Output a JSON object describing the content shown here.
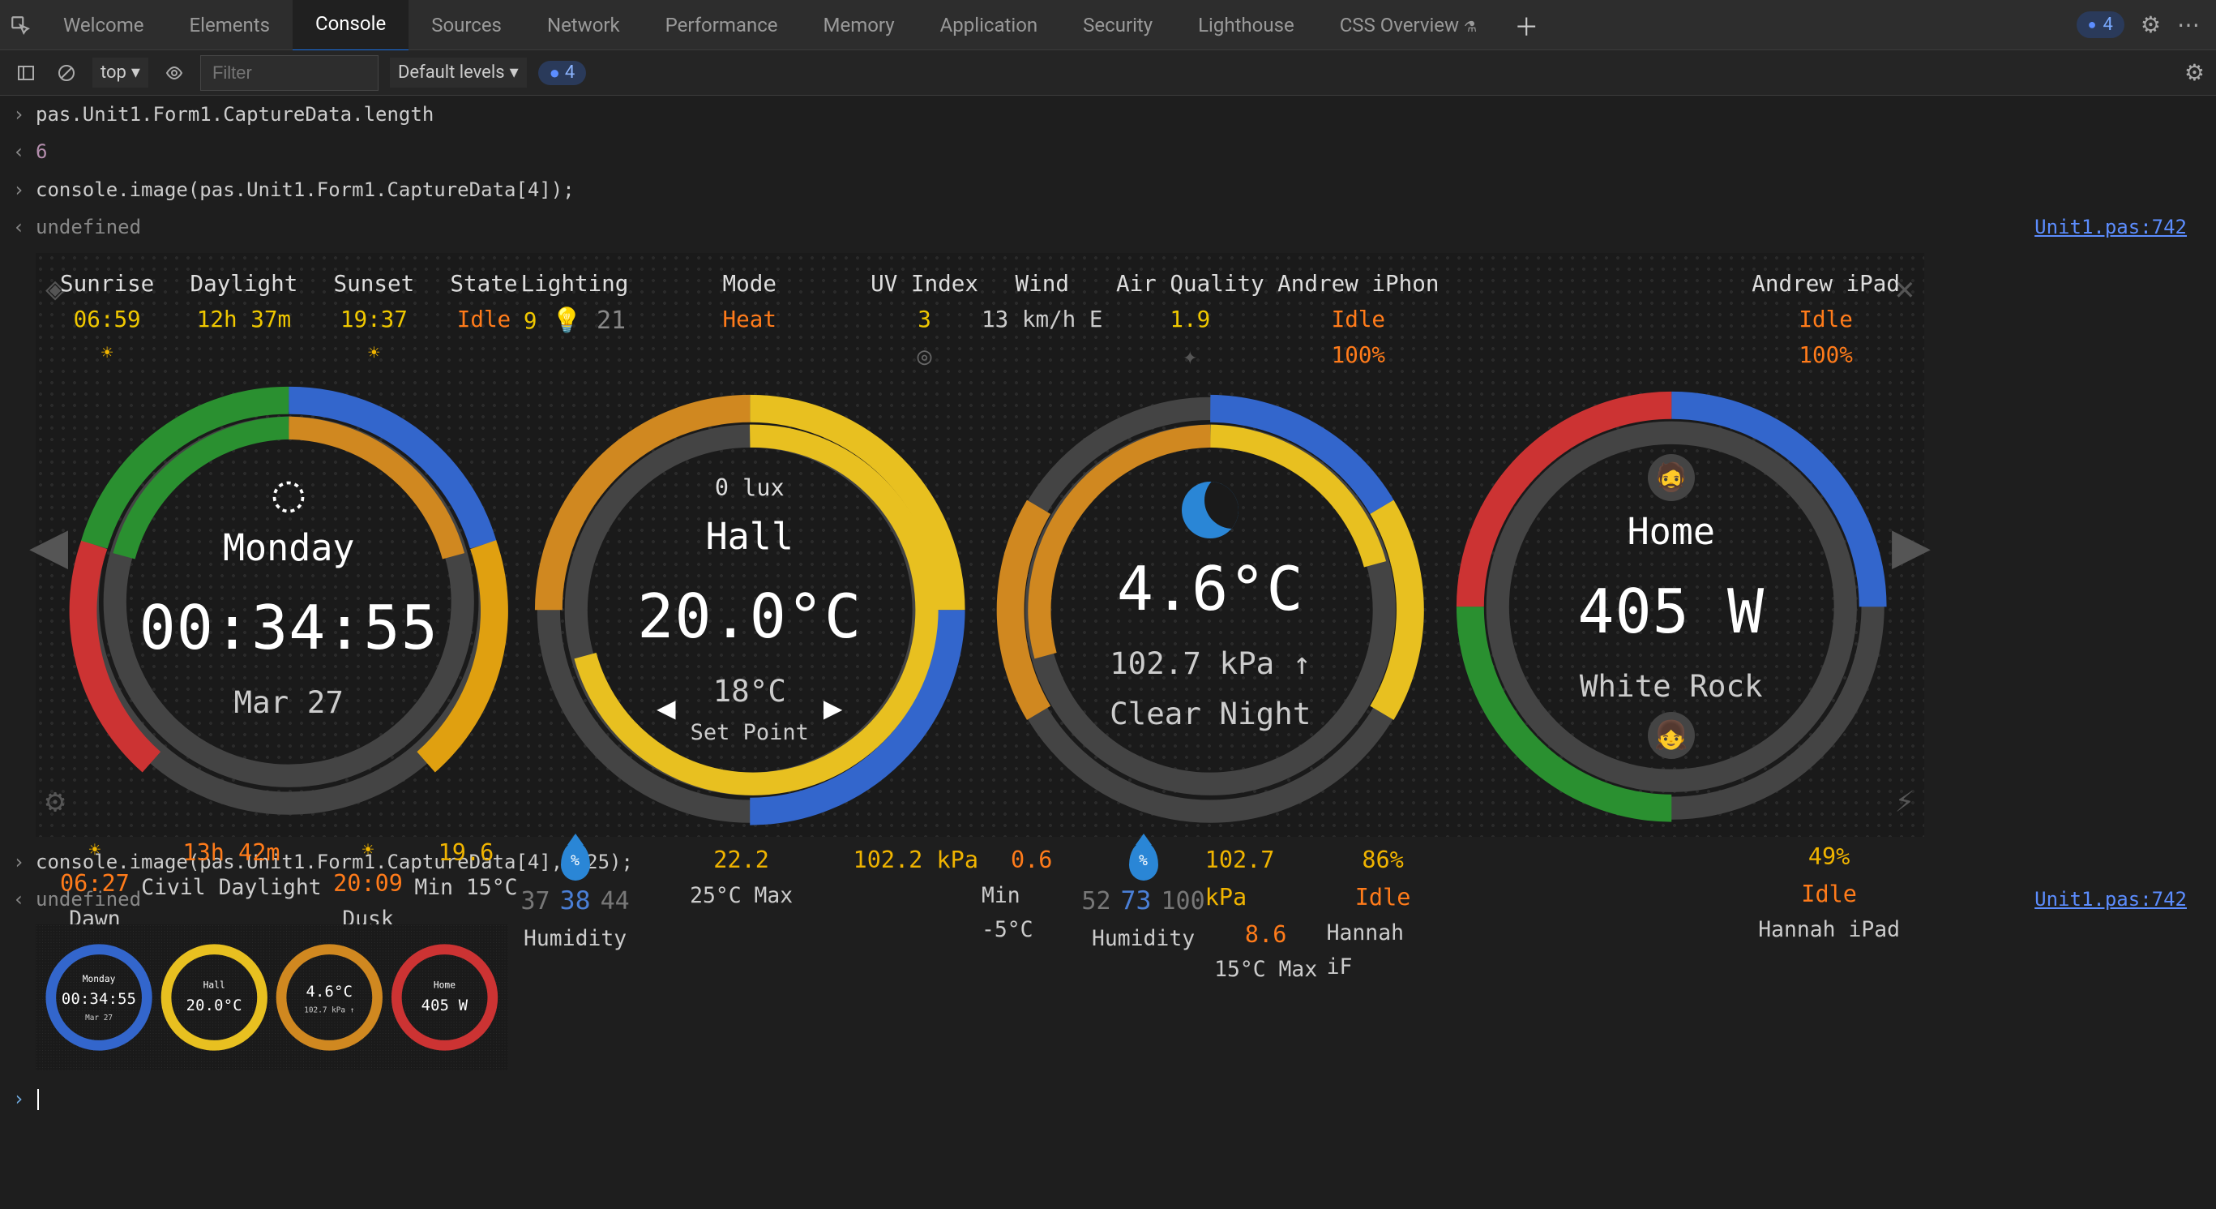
{
  "tabs": [
    "Welcome",
    "Elements",
    "Console",
    "Sources",
    "Network",
    "Performance",
    "Memory",
    "Application",
    "Security",
    "Lighthouse",
    "CSS Overview"
  ],
  "active_tab": "Console",
  "issues_count": "4",
  "filter": {
    "context": "top",
    "placeholder": "Filter",
    "levels": "Default levels",
    "issues_badge": "4"
  },
  "console": {
    "l1": "pas.Unit1.Form1.CaptureData.length",
    "l2": "6",
    "l3": "console.image(pas.Unit1.Form1.CaptureData[4]);",
    "l4": "undefined",
    "l5": "console.image(pas.Unit1.Form1.CaptureData[4],0.25);",
    "l6": "undefined",
    "source_link": "Unit1.pas:742"
  },
  "dash": {
    "cell1": {
      "h1": {
        "l": "Sunrise",
        "v": "06:59"
      },
      "h2": {
        "l": "Daylight",
        "v": "12h 37m"
      },
      "h3": {
        "l": "Sunset",
        "v": "19:37"
      },
      "h4": {
        "l": "State",
        "v": "Idle"
      },
      "center": {
        "day": "Monday",
        "big": "00:34:55",
        "sub": "Mar 27"
      },
      "f1": {
        "v": "06:27",
        "l": "Dawn"
      },
      "f2": {
        "v": "13h 42m",
        "l": "Civil Daylight"
      },
      "f3": {
        "v": "20:09",
        "l": "Dusk"
      },
      "f4": {
        "v": "19.6",
        "l": "Min 15°C"
      }
    },
    "cell2": {
      "h1": {
        "l": "Lighting",
        "v": "9",
        "v2": "21"
      },
      "h2": {
        "l": "Mode",
        "v": "Heat"
      },
      "h3": {
        "l": "UV Index",
        "v": "3"
      },
      "center": {
        "top": "0 lux",
        "day": "Hall",
        "big": "20.0°C",
        "sp": "18°C",
        "spl": "Set Point"
      },
      "f1": {
        "lo": "37",
        "mid": "38",
        "hi": "44",
        "l": "Humidity"
      },
      "f2": {
        "v": "22.2",
        "l": "25°C Max"
      },
      "f3": {
        "v": "102.2 kPa"
      }
    },
    "cell3": {
      "h1": {
        "l": "Wind",
        "v": "13 km/h E"
      },
      "h2": {
        "l": "Air Quality",
        "v": "1.9"
      },
      "h3": {
        "l": "Andrew iPhon",
        "v": "Idle",
        "pct": "100%"
      },
      "center": {
        "big": "4.6°C",
        "sub": "102.7 kPa ↑",
        "sub2": "Clear Night"
      },
      "f1": {
        "v": "0.6",
        "l": "Min -5°C"
      },
      "f2": {
        "lo": "52",
        "mid": "73",
        "hi": "100",
        "l": "Humidity"
      },
      "f3": {
        "v": "8.6",
        "l": "15°C Max"
      },
      "f4": {
        "v": "102.7 kPa"
      },
      "f5": {
        "v": "86%",
        "st": "Idle",
        "l": "Hannah iF"
      }
    },
    "cell4": {
      "h1": {
        "l": "Andrew iPad",
        "v": "Idle",
        "pct": "100%"
      },
      "center": {
        "day": "Home",
        "big": "405 W",
        "sub": "White Rock"
      },
      "f1": {
        "v": "49%",
        "st": "Idle",
        "l": "Hannah iPad"
      }
    }
  }
}
